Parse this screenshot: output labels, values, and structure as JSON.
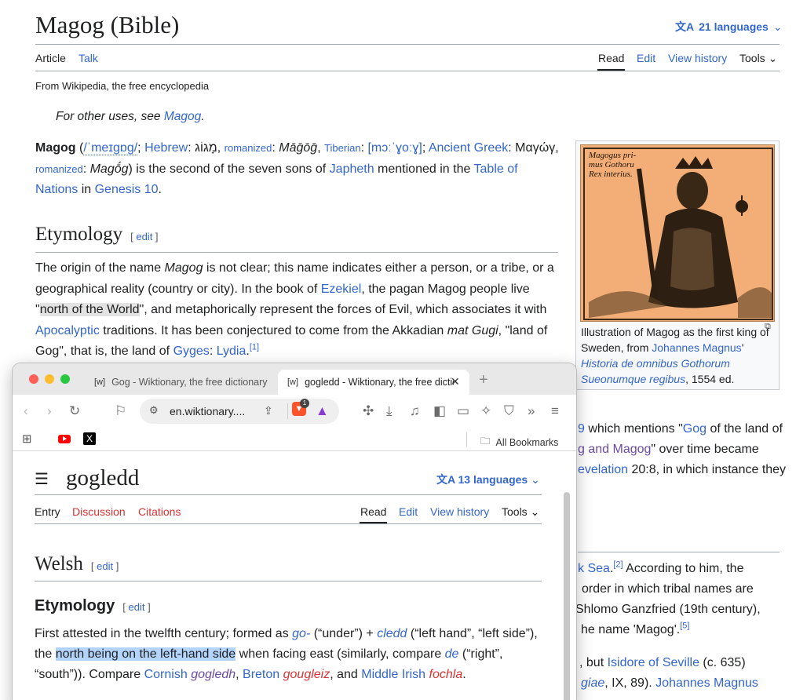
{
  "wikipedia": {
    "title": "Magog (Bible)",
    "languages_label": "21 languages",
    "tabs_left": [
      "Article",
      "Talk"
    ],
    "tabs_right": [
      "Read",
      "Edit",
      "View history",
      "Tools"
    ],
    "from": "From Wikipedia, the free encyclopedia",
    "hatnote_prefix": "For other uses, see ",
    "hatnote_link": "Magog",
    "hatnote_suffix": ".",
    "lead": {
      "term": "Magog",
      "ipa": "/ˈmeɪɡɒɡ/",
      "hebrew_label": "Hebrew",
      "hebrew_text": "מָגוֹג",
      "romanized_label": "romanized",
      "romanized_he": "Māḡōḡ",
      "tiberian_label": "Tiberian",
      "tiberian_text": "[mɔːˈɣoːɣ]",
      "greek_label": "Ancient Greek",
      "greek_text": "Μαγώγ",
      "romanized_gr": "Magṓg",
      "text1": ") is the second of the seven sons of ",
      "japheth": "Japheth",
      "text2": " mentioned in the ",
      "table": "Table of Nations",
      "text3": " in ",
      "genesis": "Genesis 10",
      "text4": "."
    },
    "etymology": {
      "heading": "Etymology",
      "edit": "edit",
      "p1": "The origin of the name ",
      "magog_italic": "Magog",
      "p2": " is not clear; this name indicates either a person, or a tribe, or a geographical reality (country or city). In the book of ",
      "ezekiel": "Ezekiel",
      "p3": ", the pagan Magog people live \"",
      "north": "north of the World",
      "p4": "\", and metaphorically represent the forces of Evil, which associates it with ",
      "apocalyptic": "Apocalyptic",
      "p5": " traditions. It has been conjectured to come from the Akkadian ",
      "mat_gugi": "mat Gugi",
      "p6": ", \"land of Gog\", that is, the land of ",
      "gyges": "Gyges",
      "colon": ": ",
      "lydia": "Lydia",
      "p7": ".",
      "ref": "[1]"
    },
    "infobox": {
      "image_text": "Magogus primus Gothorum Rex interius.",
      "caption1": "Illustration of Magog as the first king of Sweden, from ",
      "caption_link": "Johannes Magnus",
      "caption2": "' ",
      "caption_book": "Historia de omnibus Gothorum Sueonumque regibus",
      "caption3": ", 1554 ed."
    },
    "right_fragments": [
      {
        "a": "9",
        "b": " which mentions \"",
        "c": "Gog",
        "d": " of the land of"
      },
      {
        "a": "g and Magog",
        "b": "\" over time became",
        "c": "",
        "d": ""
      },
      {
        "a": "evelation",
        "b": " 20:8, in which instance they",
        "c": "",
        "d": ""
      },
      {
        "a": "k Sea",
        "b": ".",
        "c": "[2]",
        "d": " According to him, the"
      },
      {
        "a": "",
        "b": "order in which tribal names are",
        "c": "",
        "d": ""
      },
      {
        "a": "",
        "b": "Shlomo Ganzfried (19th century),",
        "c": "",
        "d": ""
      },
      {
        "a": "",
        "b": "he name 'Magog'.",
        "c": "[5]",
        "d": ""
      },
      {
        "a": "",
        "b": ", but ",
        "c": "Isidore of Seville",
        "d": " (c. 635)"
      },
      {
        "a": "giae",
        "b": ", IX, 89). ",
        "c": "Johannes Magnus",
        "d": ""
      }
    ]
  },
  "browser": {
    "tabs": [
      {
        "favicon": "[w]",
        "label": "Gog - Wiktionary, the free dictionary"
      },
      {
        "favicon": "[w]",
        "label": "gogledd - Wiktionary, the free dictionary"
      }
    ],
    "url": "en.wiktionary....",
    "brave_count": "1",
    "bookmarks_label": "All Bookmarks"
  },
  "wiktionary": {
    "title": "gogledd",
    "languages_label": "13 languages",
    "tabs_left": [
      "Entry",
      "Discussion",
      "Citations"
    ],
    "tabs_right": [
      "Read",
      "Edit",
      "View history",
      "Tools"
    ],
    "welsh": "Welsh",
    "edit": "edit",
    "etymology": "Etymology",
    "def": {
      "t1": "First attested in the twelfth century; formed as ",
      "go": "go-",
      "t2": " (“under”) + ",
      "cledd": "cledd",
      "t3": " (“left hand”, “left side”), the ",
      "hl": "north being on the left-hand side",
      "t4": " when facing east (similarly, compare ",
      "de": "de",
      "t5": " (“right”, “south”)). Compare ",
      "cornish": "Cornish",
      "gogledh": "gogledh",
      "t6": ", ",
      "breton": "Breton",
      "gougleiz": "gougleiz",
      "t7": ", and ",
      "mi": "Middle Irish",
      "fochla": "fochla",
      "t8": "."
    }
  }
}
